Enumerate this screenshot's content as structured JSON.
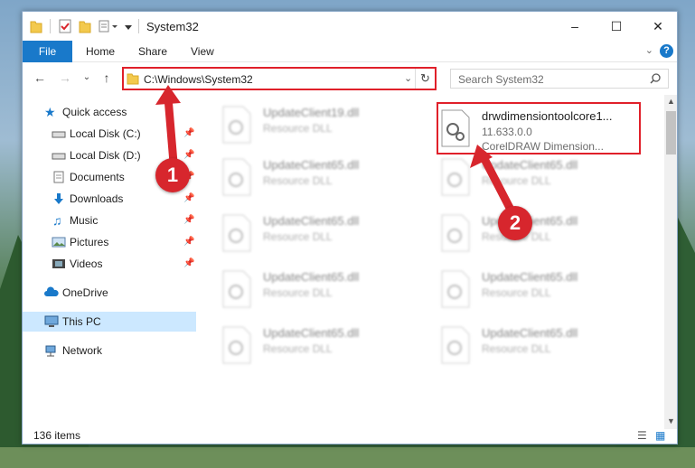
{
  "window": {
    "title": "System32"
  },
  "ribbon": {
    "tabs": [
      "File",
      "Home",
      "Share",
      "View"
    ]
  },
  "address": {
    "path": "C:\\Windows\\System32"
  },
  "search": {
    "placeholder": "Search System32"
  },
  "sidebar": {
    "quick_access": "Quick access",
    "items": [
      {
        "label": "Local Disk (C:)",
        "icon": "drive-icon"
      },
      {
        "label": "Local Disk (D:)",
        "icon": "drive-icon"
      },
      {
        "label": "Documents",
        "icon": "documents-icon"
      },
      {
        "label": "Downloads",
        "icon": "downloads-icon"
      },
      {
        "label": "Music",
        "icon": "music-icon"
      },
      {
        "label": "Pictures",
        "icon": "pictures-icon"
      },
      {
        "label": "Videos",
        "icon": "videos-icon"
      }
    ],
    "onedrive": "OneDrive",
    "thispc": "This PC",
    "network": "Network"
  },
  "files": {
    "highlighted": {
      "name": "drwdimensiontoolcore1...",
      "version": "11.633.0.0",
      "description": "CorelDRAW Dimension..."
    },
    "left": [
      {
        "name": "UpdateClient19.dll",
        "type": "Resource DLL"
      },
      {
        "name": "UpdateClient65.dll",
        "type": "Resource DLL"
      },
      {
        "name": "UpdateClient65.dll",
        "type": "Resource DLL"
      },
      {
        "name": "UpdateClient65.dll",
        "type": "Resource DLL"
      },
      {
        "name": "UpdateClient65.dll",
        "type": "Resource DLL"
      }
    ],
    "right": [
      {
        "name": "UpdateClient65.dll",
        "type": "Resource DLL"
      },
      {
        "name": "UpdateClient65.dll",
        "type": "Resource DLL"
      },
      {
        "name": "UpdateClient65.dll",
        "type": "Resource DLL"
      },
      {
        "name": "UpdateClient65.dll",
        "type": "Resource DLL"
      }
    ]
  },
  "status": {
    "count": "136 items"
  },
  "markers": {
    "one": "1",
    "two": "2"
  }
}
